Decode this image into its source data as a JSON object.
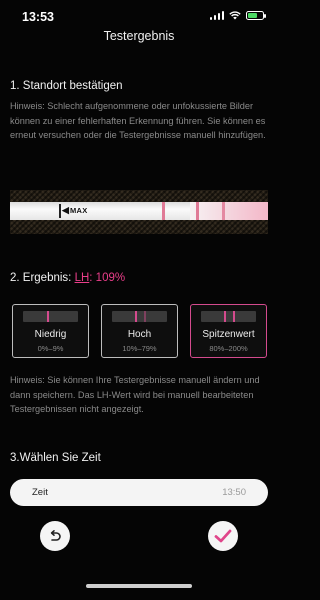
{
  "status_bar": {
    "time": "13:53"
  },
  "header": {
    "title": "Testergebnis"
  },
  "section1": {
    "title": "1. Standort bestätigen",
    "hint": "Hinweis: Schlecht aufgenommene oder unfokussierte Bilder können zu einer fehlerhaften Erkennung führen. Sie können es erneut versuchen oder die Testergebnisse manuell hinzufügen.",
    "strip_text": "MAX"
  },
  "section2": {
    "prefix": "2. Ergebnis: ",
    "lh_label": "LH",
    "value": ": 109%",
    "levels": [
      {
        "name": "Niedrig",
        "range": "0%–9%"
      },
      {
        "name": "Hoch",
        "range": "10%–79%"
      },
      {
        "name": "Spitzenwert",
        "range": "80%–200%"
      }
    ],
    "selected_level": "Spitzenwert",
    "hint": "Hinweis: Sie können Ihre Testergebnisse manuell ändern und dann speichern. Das LH-Wert wird bei manuell bearbeiteten Testergebnissen nicht angezeigt."
  },
  "section3": {
    "title": "3.Wählen Sie Zeit",
    "time_label": "Zeit",
    "time_value": "13:50"
  },
  "colors": {
    "accent": "#ea3e8a",
    "background": "#050505"
  },
  "icons": {
    "back": "undo-icon",
    "confirm": "checkmark-icon"
  }
}
